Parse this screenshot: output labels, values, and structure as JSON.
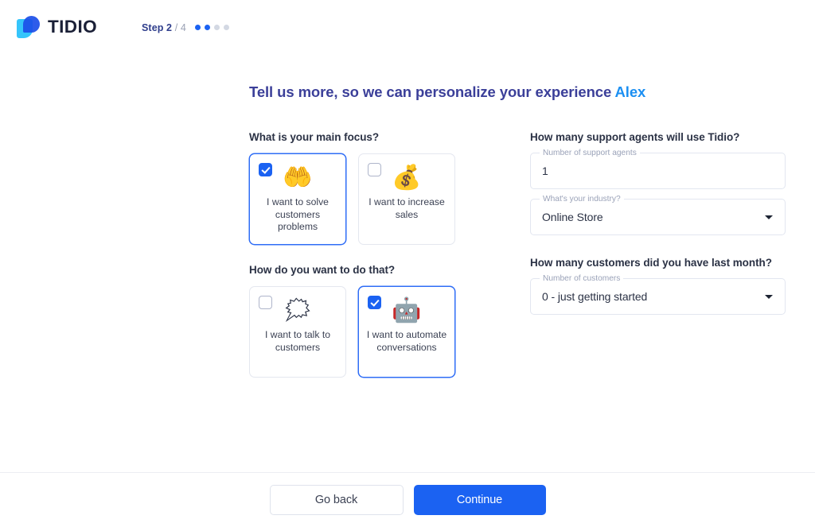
{
  "brand": {
    "name": "TIDIO",
    "logo_icon": "tidio-logo-icon",
    "accent": "#1b62f2"
  },
  "progress": {
    "current_label": "Step 2",
    "total_label": "/ 4",
    "current": 2,
    "total": 4,
    "dots": [
      true,
      true,
      false,
      false
    ],
    "active_color": "#1b62f2",
    "inactive_color": "#d3d8e3"
  },
  "headline": {
    "text": "Tell us more, so we can personalize your experience ",
    "user_name": "Alex",
    "color": "#3b3f99",
    "user_name_color": "#1b8ff2"
  },
  "left_column": {
    "focus": {
      "question": "What is your main focus?",
      "options": [
        {
          "label": "I want to solve customers problems",
          "emoji": "🤲",
          "emoji_name": "palms-up-together-icon",
          "checked": true
        },
        {
          "label": "I want to increase sales",
          "emoji": "💰",
          "emoji_name": "money-bag-icon",
          "checked": false
        }
      ]
    },
    "method": {
      "question": "How do you want to do that?",
      "options": [
        {
          "label": "I want to talk to customers",
          "emoji": "🗯",
          "emoji_name": "speech-balloon-icon",
          "checked": false
        },
        {
          "label": "I want to automate conversations",
          "emoji": "🤖",
          "emoji_name": "robot-icon",
          "checked": true
        }
      ]
    }
  },
  "right_column": {
    "agents": {
      "question": "How many support agents will use Tidio?",
      "field_label": "Number of support agents",
      "value": "1",
      "placeholder": "Number of support agents"
    },
    "industry": {
      "field_label": "What's your industry?",
      "value": "Online Store",
      "caret_icon": "chevron-down-icon"
    },
    "customers": {
      "question": "How many customers did you have last month?",
      "field_label": "Number of customers",
      "value": "0 - just getting started",
      "caret_icon": "chevron-down-icon"
    }
  },
  "footer": {
    "back_label": "Go back",
    "continue_label": "Continue"
  }
}
